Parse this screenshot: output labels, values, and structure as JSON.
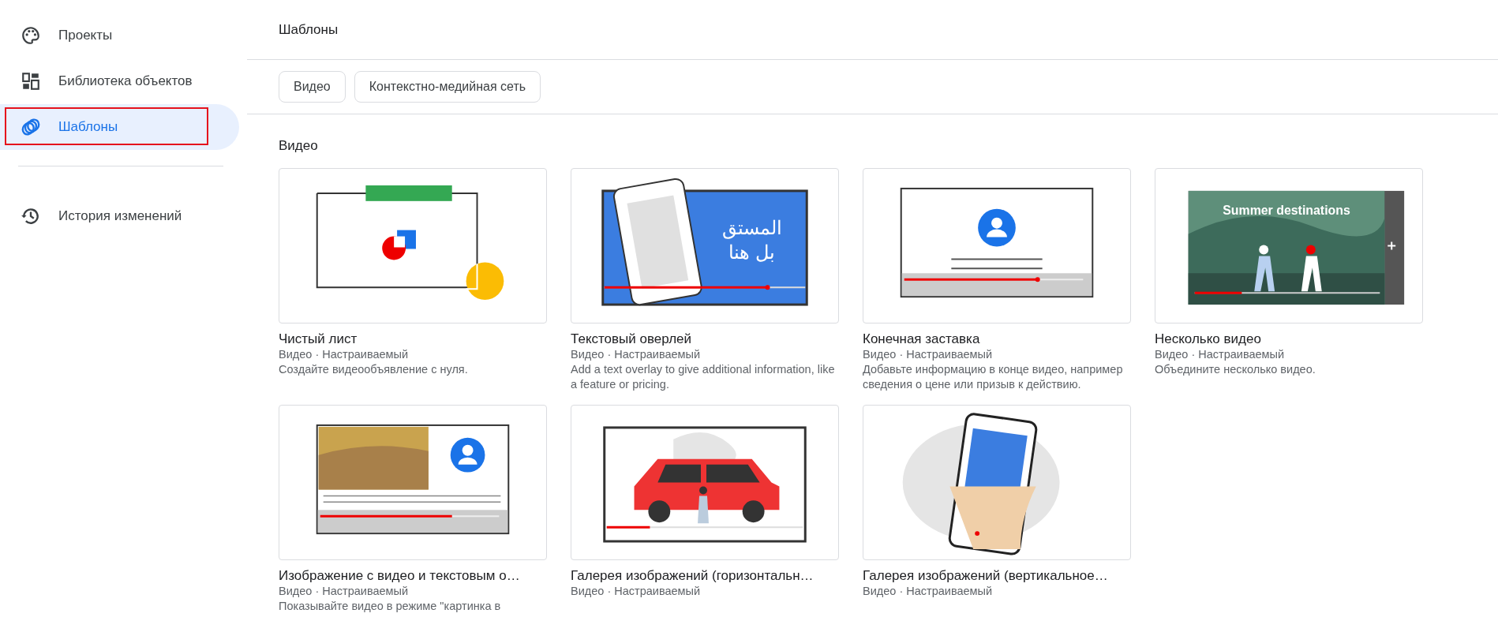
{
  "sidebar": {
    "items": [
      {
        "label": "Проекты",
        "kind": "palette",
        "selected": false,
        "highlighted": false
      },
      {
        "label": "Библиотека объектов",
        "kind": "dashboard",
        "selected": false,
        "highlighted": false
      },
      {
        "label": "Шаблоны",
        "kind": "rings",
        "selected": true,
        "highlighted": true
      },
      {
        "label": "История изменений",
        "kind": "history",
        "selected": false,
        "highlighted": false
      }
    ]
  },
  "header": {
    "title": "Шаблоны"
  },
  "filters": [
    {
      "label": "Видео"
    },
    {
      "label": "Контекстно-медийная сеть"
    }
  ],
  "section": {
    "title": "Видео"
  },
  "cards": [
    {
      "kind": "blank",
      "title": "Чистый лист",
      "meta": "Видео · Настраиваемый",
      "description": "Создайте видеообъявление с нуля."
    },
    {
      "kind": "text-overlay",
      "thumb_text": [
        "المستق",
        "بل هنا"
      ],
      "title": "Текстовый оверлей",
      "meta": "Видео · Настраиваемый",
      "description": "Add a text overlay to give additional information, like a feature or pricing."
    },
    {
      "kind": "end-screen",
      "title": "Конечная заставка",
      "meta": "Видео · Настраиваемый",
      "description": "Добавьте информацию в конце видео, например сведения о цене или призыв к действию."
    },
    {
      "kind": "multi-video",
      "thumb_text": [
        "Summer destinations"
      ],
      "title": "Несколько видео",
      "meta": "Видео · Настраиваемый",
      "description": "Объедините несколько видео."
    },
    {
      "kind": "image-video-text",
      "title": "Изображение с видео и текстовым о…",
      "meta": "Видео · Настраиваемый",
      "description": "Показывайте видео в режиме \"картинка в"
    },
    {
      "kind": "gallery-horizontal",
      "title": "Галерея изображений (горизонтальн…",
      "meta": "Видео · Настраиваемый"
    },
    {
      "kind": "gallery-vertical",
      "title": "Галерея изображений (вертикальное…",
      "meta": "Видео · Настраиваемый"
    }
  ]
}
